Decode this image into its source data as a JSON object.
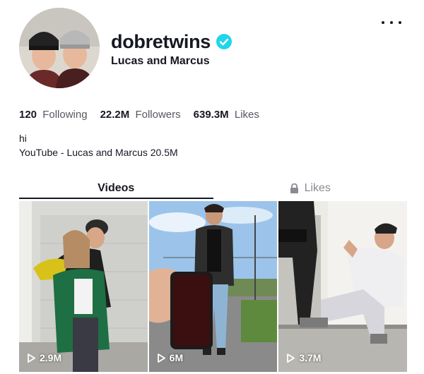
{
  "profile": {
    "username": "dobretwins",
    "display_name": "Lucas and Marcus",
    "verified": true,
    "bio_lines": [
      "hi",
      "YouTube - Lucas and Marcus 20.5M"
    ]
  },
  "stats": {
    "following": {
      "value": "120",
      "label": "Following"
    },
    "followers": {
      "value": "22.2M",
      "label": "Followers"
    },
    "likes": {
      "value": "639.3M",
      "label": "Likes"
    }
  },
  "tabs": [
    {
      "label": "Videos",
      "active": true
    },
    {
      "label": "Likes",
      "active": false,
      "icon": "lock-icon"
    }
  ],
  "videos": [
    {
      "views": "2.9M",
      "icon": "play-icon"
    },
    {
      "views": "6M",
      "icon": "play-icon"
    },
    {
      "views": "3.7M",
      "icon": "play-icon"
    }
  ],
  "colors": {
    "verified": "#20d5ec",
    "text": "#161823",
    "muted": "#8a8b91"
  }
}
